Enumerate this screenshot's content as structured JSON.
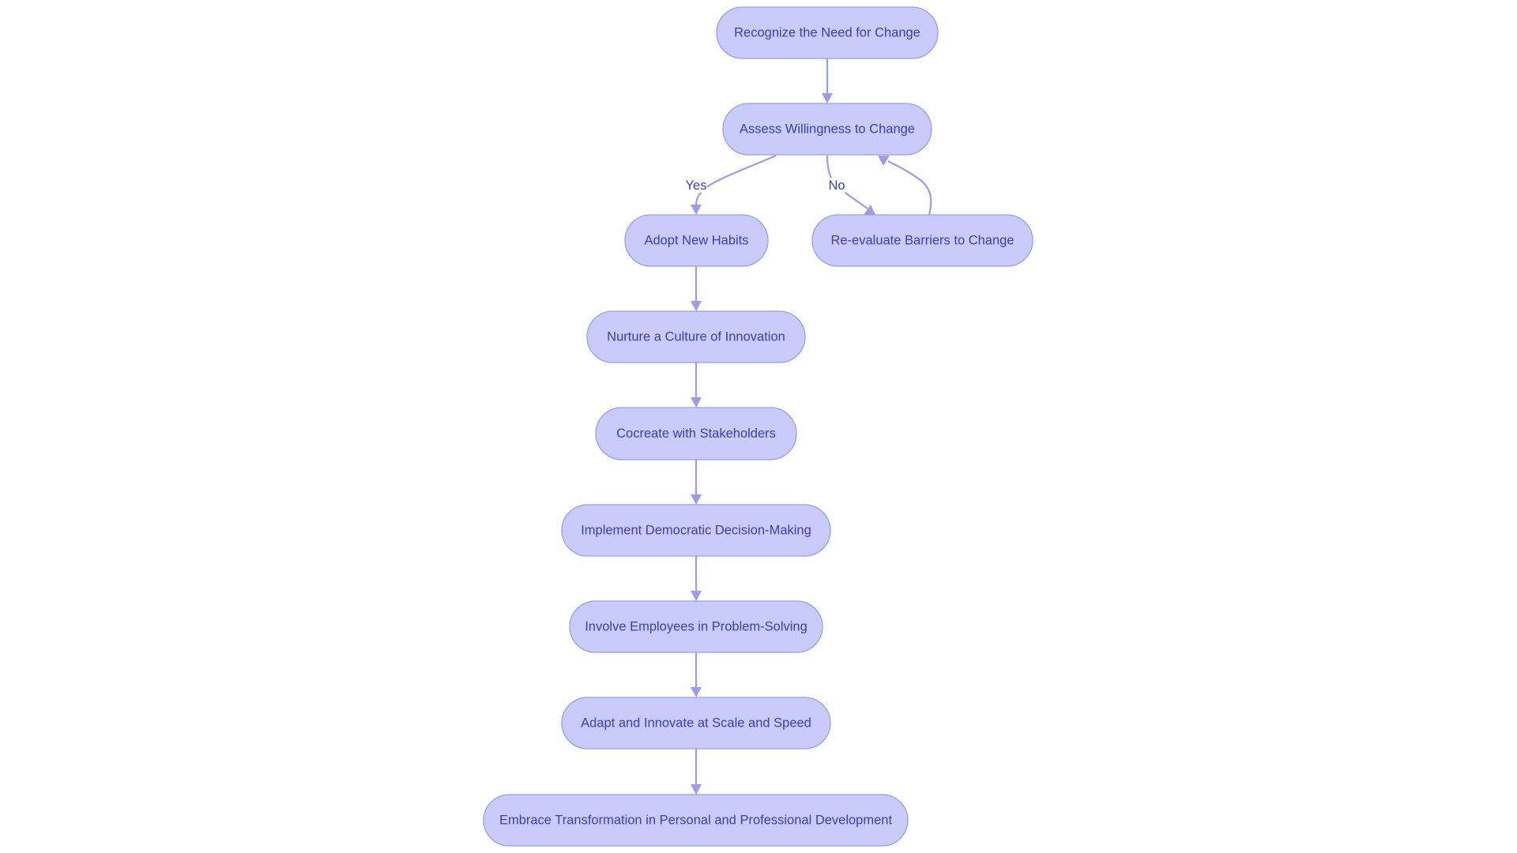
{
  "diagram": {
    "type": "flowchart",
    "direction": "top-down",
    "colors": {
      "node_fill": "#c9cbfa",
      "node_stroke": "#9a9ee8",
      "text": "#3a3fb4",
      "edge": "#9a9ee8"
    },
    "nodes": [
      {
        "id": "recognize",
        "label": "Recognize the Need for Change"
      },
      {
        "id": "assess",
        "label": "Assess Willingness to Change"
      },
      {
        "id": "adopt",
        "label": "Adopt New Habits"
      },
      {
        "id": "reevaluate",
        "label": "Re-evaluate Barriers to Change"
      },
      {
        "id": "nurture",
        "label": "Nurture a Culture of Innovation"
      },
      {
        "id": "cocreate",
        "label": "Cocreate with Stakeholders"
      },
      {
        "id": "implement",
        "label": "Implement Democratic Decision-Making"
      },
      {
        "id": "involve",
        "label": "Involve Employees in Problem-Solving"
      },
      {
        "id": "adapt",
        "label": "Adapt and Innovate at Scale and Speed"
      },
      {
        "id": "embrace",
        "label": "Embrace Transformation in Personal and Professional Development"
      }
    ],
    "edges": [
      {
        "from": "recognize",
        "to": "assess",
        "label": ""
      },
      {
        "from": "assess",
        "to": "adopt",
        "label": "Yes"
      },
      {
        "from": "assess",
        "to": "reevaluate",
        "label": "No"
      },
      {
        "from": "reevaluate",
        "to": "assess",
        "label": ""
      },
      {
        "from": "adopt",
        "to": "nurture",
        "label": ""
      },
      {
        "from": "nurture",
        "to": "cocreate",
        "label": ""
      },
      {
        "from": "cocreate",
        "to": "implement",
        "label": ""
      },
      {
        "from": "implement",
        "to": "involve",
        "label": ""
      },
      {
        "from": "involve",
        "to": "adapt",
        "label": ""
      },
      {
        "from": "adapt",
        "to": "embrace",
        "label": ""
      }
    ]
  }
}
